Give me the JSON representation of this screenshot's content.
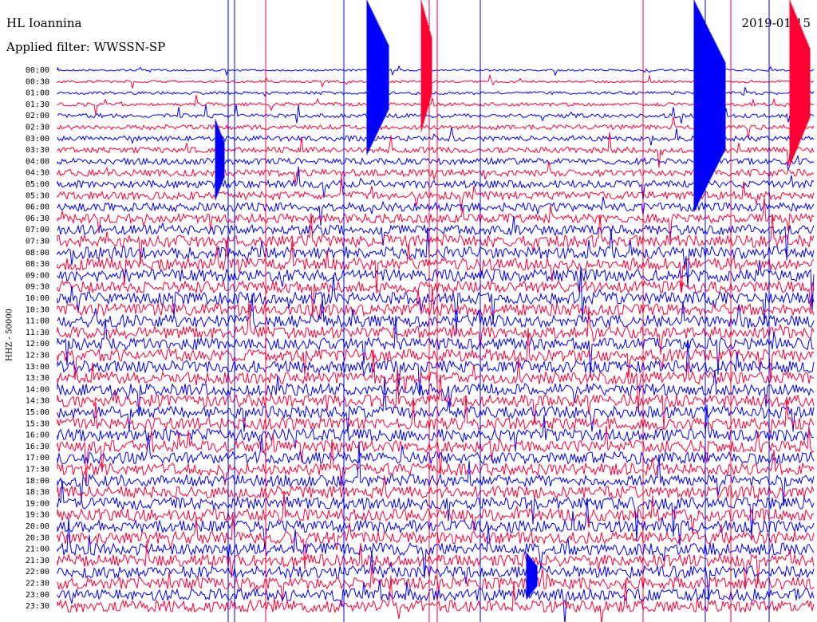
{
  "header": {
    "station": "HL Ioannina",
    "filter": "Applied filter: WWSSN-SP",
    "date": "2019-01-15"
  },
  "chart_data": {
    "type": "line",
    "title": "HL Ioannina",
    "ylabel": "HHZ - 50000",
    "trace_colors": [
      "#0000ff",
      "#ff0033"
    ],
    "row_times": [
      "00:00",
      "00:30",
      "01:00",
      "01:30",
      "02:00",
      "02:30",
      "03:00",
      "03:30",
      "04:00",
      "04:30",
      "05:00",
      "05:30",
      "06:00",
      "06:30",
      "07:00",
      "07:30",
      "08:00",
      "08:30",
      "09:00",
      "09:30",
      "10:00",
      "10:30",
      "11:00",
      "11:30",
      "12:00",
      "12:30",
      "13:00",
      "13:30",
      "14:00",
      "14:30",
      "15:00",
      "15:30",
      "16:00",
      "16:30",
      "17:00",
      "17:30",
      "18:00",
      "18:30",
      "19:00",
      "19:30",
      "20:00",
      "20:30",
      "21:00",
      "21:30",
      "22:00",
      "22:30",
      "23:00",
      "23:30"
    ],
    "grid": false
  }
}
